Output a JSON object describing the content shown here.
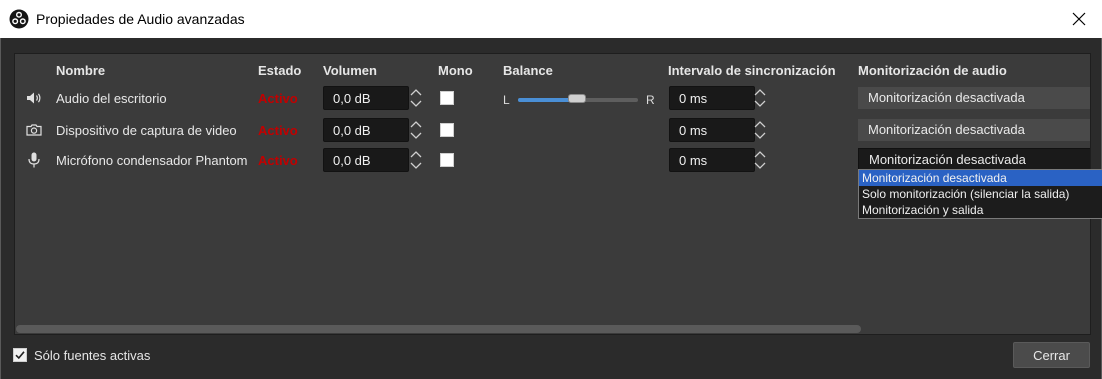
{
  "window": {
    "title": "Propiedades de Audio avanzadas",
    "app_icon": "obs-logo-icon",
    "close_icon": "close-icon"
  },
  "headers": {
    "name": "Nombre",
    "state": "Estado",
    "volume": "Volumen",
    "mono": "Mono",
    "balance": "Balance",
    "sync": "Intervalo de sincronización",
    "monitoring": "Monitorización de audio"
  },
  "rows": [
    {
      "icon": "speaker-icon",
      "name": "Audio del escritorio",
      "state": "Activo",
      "volume": "0,0 dB",
      "mono": false,
      "balance": {
        "left": "L",
        "right": "R",
        "value": 0.5
      },
      "sync": "0 ms",
      "monitoring": "Monitorización desactivada"
    },
    {
      "icon": "camera-icon",
      "name": "Dispositivo de captura de video",
      "state": "Activo",
      "volume": "0,0 dB",
      "mono": false,
      "sync": "0 ms",
      "monitoring": "Monitorización desactivada"
    },
    {
      "icon": "microphone-icon",
      "name": "Micrófono condensador Phantom",
      "state": "Activo",
      "volume": "0,0 dB",
      "mono": false,
      "sync": "0 ms",
      "monitoring": "Monitorización desactivada"
    }
  ],
  "dropdown": {
    "options": [
      "Monitorización desactivada",
      "Solo monitorización (silenciar la salida)",
      "Monitorización y salida"
    ],
    "selected_index": 0
  },
  "footer": {
    "active_only_label": "Sólo fuentes activas",
    "active_only_checked": true,
    "close_label": "Cerrar"
  },
  "colors": {
    "active_state": "#c20000",
    "slider_fill": "#4a8fd6",
    "selection": "#2a62c4"
  }
}
